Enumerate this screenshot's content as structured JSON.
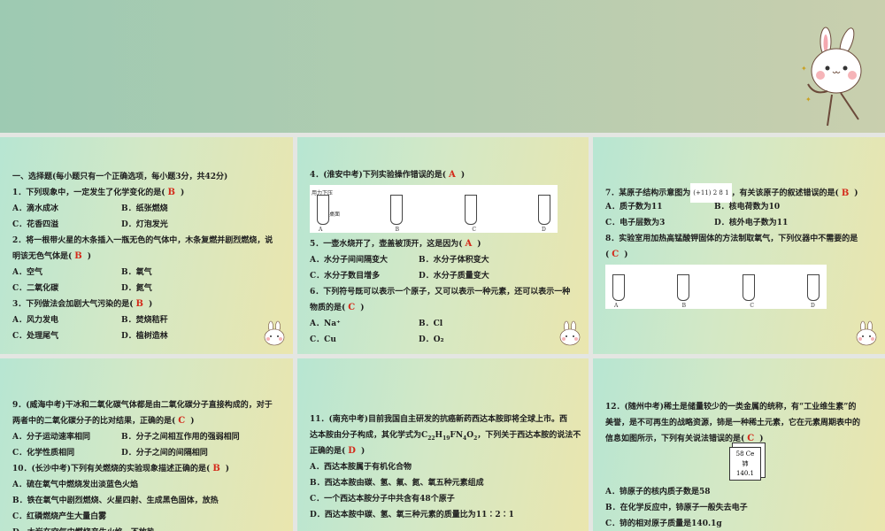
{
  "panels": [
    {
      "items": [
        {
          "t": "text",
          "text": "一、选择题(每小题只有一个正确选项，每小题3分，共42分)"
        },
        {
          "t": "q",
          "pre": "1．下列现象中，一定发生了化学变化的是(",
          "ans": "B",
          "post": ")"
        },
        {
          "t": "opts",
          "o": [
            "A．滴水成冰",
            "B．纸张燃烧"
          ]
        },
        {
          "t": "opts",
          "o": [
            "C．花香四溢",
            "D．灯泡发光"
          ]
        },
        {
          "t": "text",
          "text": "2．将一根带火星的木条插入一瓶无色的气体中，木条复燃并剧烈燃烧，说"
        },
        {
          "t": "q",
          "pre": "明该无色气体是(",
          "ans": "B",
          "post": ")"
        },
        {
          "t": "opts",
          "o": [
            "A．空气",
            "B．氧气"
          ]
        },
        {
          "t": "opts",
          "o": [
            "C．二氧化碳",
            "D．氮气"
          ]
        },
        {
          "t": "q",
          "pre": "3．下列做法会加剧大气污染的是(",
          "ans": "B",
          "post": ")"
        },
        {
          "t": "opts",
          "o": [
            "A．风力发电",
            "B．焚烧秸秆"
          ]
        },
        {
          "t": "opts",
          "o": [
            "C．处理尾气",
            "D．植树造林"
          ]
        }
      ]
    },
    {
      "items": [
        {
          "t": "q",
          "pre": "4．(淮安中考)下列实验操作错误的是(",
          "ans": "A",
          "post": ")"
        },
        {
          "t": "fig",
          "w": 280,
          "h": 54,
          "labels": [
            "A",
            "B",
            "C",
            "D"
          ],
          "notes": [
            "用力下压",
            "桌面"
          ]
        },
        {
          "t": "q",
          "pre": "5．一壶水烧开了，壶盖被顶开，这是因为(",
          "ans": "A",
          "post": ")"
        },
        {
          "t": "opts",
          "o": [
            "A．水分子间间隔变大",
            "B．水分子体积变大"
          ]
        },
        {
          "t": "opts",
          "o": [
            "C．水分子数目增多",
            "D．水分子质量变大"
          ]
        },
        {
          "t": "text",
          "text": "6．下列符号既可以表示一个原子，又可以表示一种元素，还可以表示一种"
        },
        {
          "t": "q",
          "pre": "物质的是(",
          "ans": "C",
          "post": ")"
        },
        {
          "t": "opts",
          "o": [
            "A．Na⁺",
            "B．Cl"
          ]
        },
        {
          "t": "opts",
          "o": [
            "C．Cu",
            "D．O₂"
          ]
        }
      ]
    },
    {
      "items": [
        {
          "t": "atomq",
          "pre": "7．某原子结构示意图为",
          "atom": "(+11) 2 8 1",
          "mid": "，有关该原子的叙述错误的是(",
          "ans": "B",
          "post": ")"
        },
        {
          "t": "opts",
          "o": [
            "A．质子数为11",
            "B．核电荷数为10"
          ]
        },
        {
          "t": "opts",
          "o": [
            "C．电子层数为3",
            "D．核外电子数为11"
          ]
        },
        {
          "t": "text",
          "text": "8．实验室用加热高锰酸钾固体的方法制取氧气，下列仪器中不需要的是"
        },
        {
          "t": "q",
          "pre": "(",
          "ans": "C",
          "post": ")"
        },
        {
          "t": "fig",
          "w": 250,
          "h": 50,
          "labels": [
            "A",
            "B",
            "C",
            "D"
          ],
          "notes": []
        }
      ]
    },
    {
      "items": [
        {
          "t": "text",
          "text": "9．(威海中考)干冰和二氧化碳气体都是由二氧化碳分子直接构成的，对于"
        },
        {
          "t": "q",
          "pre": "两者中的二氧化碳分子的比对结果，正确的是(",
          "ans": "C",
          "post": ")"
        },
        {
          "t": "opts",
          "o": [
            "A．分子运动速率相同",
            "B．分子之间相互作用的强弱相同"
          ]
        },
        {
          "t": "opts",
          "o": [
            "C．化学性质相同",
            "D．分子之间的间隔相同"
          ]
        },
        {
          "t": "q",
          "pre": "10．(长沙中考)下列有关燃烧的实验现象描述正确的是(",
          "ans": "B",
          "post": ")"
        },
        {
          "t": "text",
          "text": "A．硫在氧气中燃烧发出淡蓝色火焰"
        },
        {
          "t": "text",
          "text": "B．铁在氧气中剧烈燃烧、火星四射、生成黑色固体，放热"
        },
        {
          "t": "text",
          "text": "C．红磷燃烧产生大量白雾"
        },
        {
          "t": "text",
          "text": "D．木炭在空气中燃烧产生火焰，不放热"
        }
      ]
    },
    {
      "items": [
        {
          "t": "text",
          "text": "11．(南充中考)目前我国自主研发的抗癌新药西达本胺即将全球上市。西"
        },
        {
          "t": "formula",
          "pre": "达本胺由分子构成，其化学式为",
          "parts": [
            [
              "C",
              "22"
            ],
            [
              "H",
              "19"
            ],
            [
              "F",
              ""
            ],
            [
              "N",
              "4"
            ],
            [
              "O",
              "2"
            ]
          ],
          "post": "，下列关于西达本胺的说法不"
        },
        {
          "t": "q",
          "pre": "正确的是(",
          "ans": "D",
          "post": ")"
        },
        {
          "t": "text",
          "text": "A．西达本胺属于有机化合物"
        },
        {
          "t": "text",
          "text": "B．西达本胺由碳、氢、氟、氮、氧五种元素组成"
        },
        {
          "t": "text",
          "text": "C．一个西达本胺分子中共含有48个原子"
        },
        {
          "t": "text",
          "text": "D．西达本胺中碳、氢、氧三种元素的质量比为11∶2∶1"
        }
      ]
    },
    {
      "items": [
        {
          "t": "text",
          "text": "12．(随州中考)稀土是储量较少的一类金属的统称，有“工业维生素”的"
        },
        {
          "t": "text",
          "text": "美誉，是不可再生的战略资源，铈是一种稀土元素，它在元素周期表中的"
        },
        {
          "t": "q",
          "pre": "信息如图所示，下列有关说法错误的是(",
          "ans": "C",
          "post": ")"
        },
        {
          "t": "elem",
          "lines": [
            "58   Ce",
            "铈",
            "140.1"
          ]
        },
        {
          "t": "text",
          "text": "A．铈原子的核内质子数是58"
        },
        {
          "t": "text",
          "text": "B．在化学反应中，铈原子一般失去电子"
        },
        {
          "t": "text",
          "text": "C．铈的相对原子质量是140.1g"
        }
      ]
    }
  ],
  "colors": {
    "answer": "#d42a1a"
  }
}
